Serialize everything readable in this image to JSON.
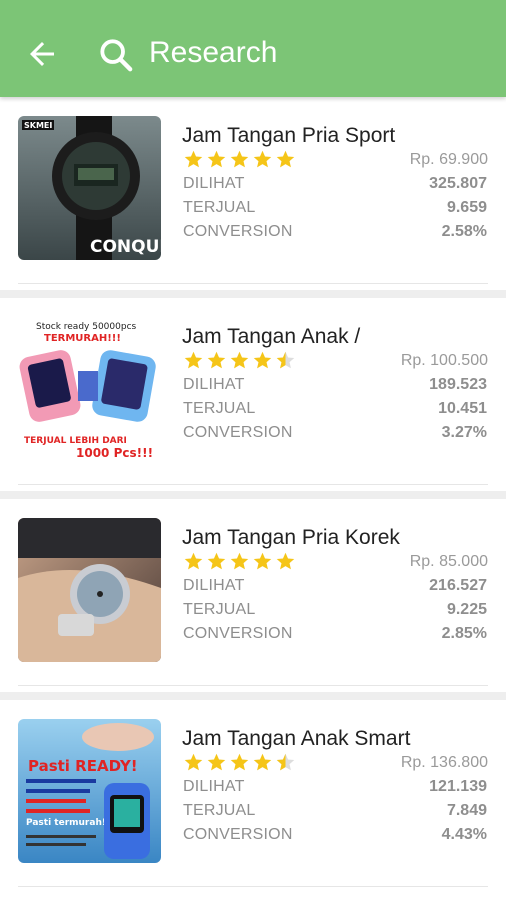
{
  "header": {
    "title": "Research",
    "back_icon": "arrow-back-icon",
    "search_icon": "search-icon",
    "bg_color": "#7cc576"
  },
  "labels": {
    "views": "DILIHAT",
    "sold": "TERJUAL",
    "conversion": "CONVERSION"
  },
  "products": [
    {
      "name": "Jam Tangan Pria Sport",
      "rating": 5,
      "price": "Rp. 69.900",
      "views": "325.807",
      "sold": "9.659",
      "conversion": "2.58%",
      "image_text": "CONQUER",
      "image_brand": "SKMEI"
    },
    {
      "name": "Jam Tangan Anak /",
      "rating": 4.5,
      "price": "Rp. 100.500",
      "views": "189.523",
      "sold": "10.451",
      "conversion": "3.27%",
      "image_text_1": "Stock ready 50000pcs",
      "image_text_2": "TERMURAH!!!",
      "image_text_3": "TERJUAL LEBIH DARI",
      "image_text_4": "1000 Pcs!!!"
    },
    {
      "name": "Jam Tangan Pria Korek",
      "rating": 5,
      "price": "Rp. 85.000",
      "views": "216.527",
      "sold": "9.225",
      "conversion": "2.85%"
    },
    {
      "name": "Jam Tangan Anak Smart",
      "rating": 4.5,
      "price": "Rp. 136.800",
      "views": "121.139",
      "sold": "7.849",
      "conversion": "4.43%",
      "image_text_1": "Pasti READY!",
      "image_text_2": "Pasti termurah!"
    }
  ],
  "colors": {
    "star": "#f5c518",
    "star_empty": "#dddddd"
  }
}
